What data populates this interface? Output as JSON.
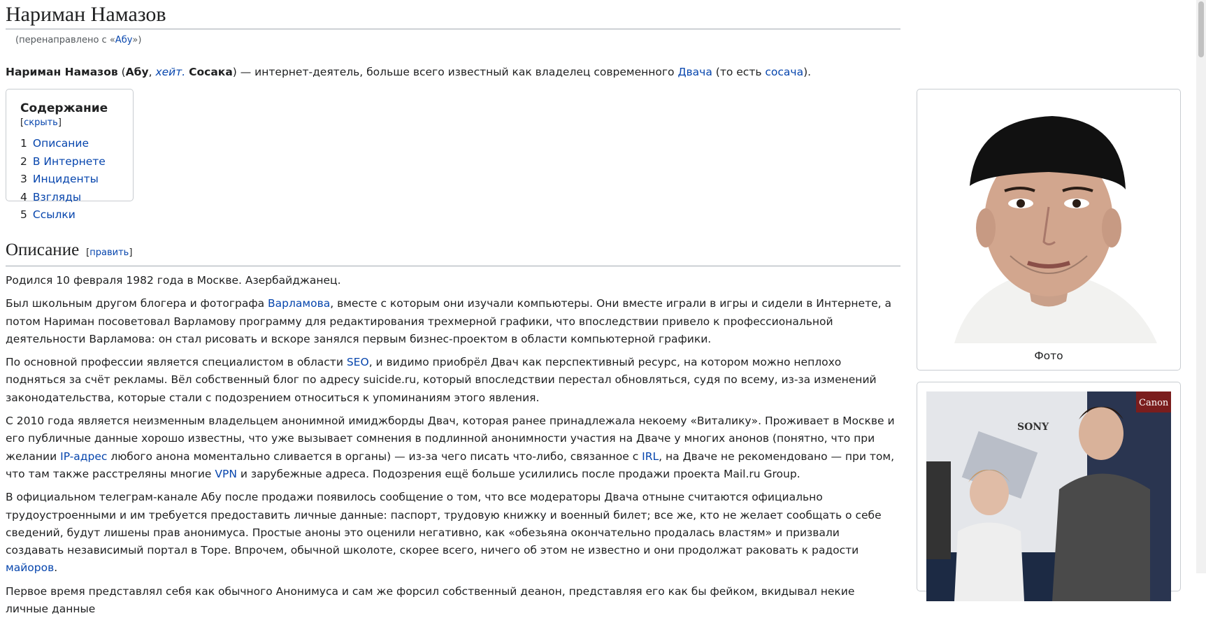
{
  "title": "Нариман Намазов",
  "redirect": {
    "prefix": "(перенаправлено с «",
    "link": "Абу",
    "suffix": "»)"
  },
  "lead": {
    "name": "Нариман Намазов",
    "p1": " (",
    "alias1": "Абу",
    "sep": ", ",
    "alias2": "хейт.",
    "sp": " ",
    "alias3": "Сосака",
    "p2": ") — интернет-деятель, больше всего известный как владелец современного ",
    "link1": "Двача",
    "p3": " (то есть ",
    "link2": "сосача",
    "p4": ")."
  },
  "toc": {
    "title": "Содержание",
    "toggle_open": "[",
    "toggle": "скрыть",
    "toggle_close": "]",
    "items": [
      {
        "num": "1",
        "label": "Описание"
      },
      {
        "num": "2",
        "label": "В Интернете"
      },
      {
        "num": "3",
        "label": "Инциденты"
      },
      {
        "num": "4",
        "label": "Взгляды"
      },
      {
        "num": "5",
        "label": "Ссылки"
      }
    ]
  },
  "section": {
    "heading": "Описание",
    "edit_open": "[",
    "edit": "править",
    "edit_close": "]",
    "p1": "Родился 10 февраля 1982 года в Москве. Азербайджанец.",
    "p2a": "Был школьным другом блогера и фотографа ",
    "p2link": "Варламова",
    "p2b": ", вместе с которым они изучали компьютеры. Они вместе играли в игры и сидели в Интернете, а потом Нариман посоветовал Варламову программу для редактирования трехмерной графики, что впоследствии привело к профессиональной деятельности Варламова: он стал рисовать и вскоре занялся первым бизнес-проектом в области компьютерной графики.",
    "p3a": "По основной профессии является специалистом в области ",
    "p3link": "SEO",
    "p3b": ", и видимо приобрёл Двач как перспективный ресурс, на котором можно неплохо подняться за счёт рекламы. Вёл собственный блог по адресу suicide.ru, который впоследствии перестал обновляться, судя по всему, из-за изменений законодательства, которые стали с подозрением относиться к упоминаниям этого явления.",
    "p4a": "С 2010 года является неизменным владельцем анонимной имиджборды Двач, которая ранее принадлежала некоему «Виталику». Проживает в Москве и его публичные данные хорошо известны, что уже вызывает сомнения в подлинной анонимности участия на Дваче у многих анонов (понятно, что при желании ",
    "p4link1": "IP-адрес",
    "p4b": " любого анона моментально сливается в органы) — из-за чего писать что-либо, связанное с ",
    "p4link2": "IRL",
    "p4c": ", на Дваче не рекомендовано — при том, что там также расстреляны многие ",
    "p4link3": "VPN",
    "p4d": " и зарубежные адреса. Подозрения ещё больше усилились после продажи проекта Mail.ru Group.",
    "p5a": "В официальном телеграм-канале Абу после продажи появилось сообщение о том, что все модераторы Двача отныне считаются официально трудоустроенными и им требуется предоставить личные данные: паспорт, трудовую книжку и военный билет; все же, кто не желает сообщать о себе сведений, будут лишены прав анонимуса. Простые аноны это оценили негативно, как «обезьяна окончательно продалась властям» и призвали создавать независимый портал в Торе. Впрочем, обычной школоте, скорее всего, ничего об этом не известно и они продолжат раковать к радости ",
    "p5link": "майоров",
    "p5b": ".",
    "p6": "Первое время представлял себя как обычного Анонимуса и сам же форсил собственный деанон, представляя его как бы фейком, вкидывал некие личные данные"
  },
  "infobox1": {
    "caption": "Фото"
  },
  "infobox2": {
    "sign1": "SONY",
    "sign2": "Canon"
  },
  "colors": {
    "link": "#0645ad",
    "text": "#202122",
    "border": "#c8ccd1"
  }
}
